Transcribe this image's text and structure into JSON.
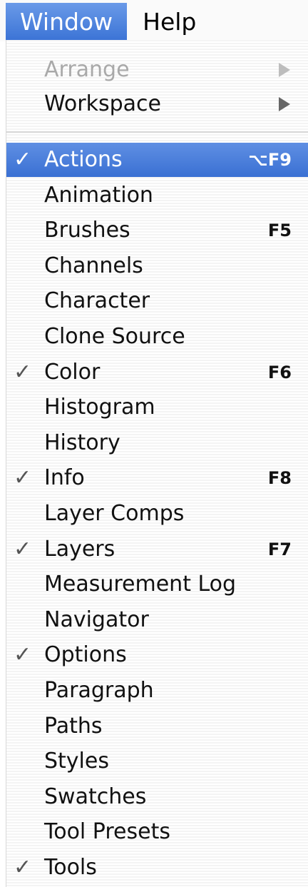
{
  "menubar": {
    "items": [
      {
        "label": "Window"
      },
      {
        "label": "Help"
      }
    ]
  },
  "menu": {
    "top_items": [
      {
        "label": "Arrange",
        "submenu": true,
        "enabled": false
      },
      {
        "label": "Workspace",
        "submenu": true,
        "enabled": true
      }
    ],
    "items": [
      {
        "label": "Actions",
        "checked": true,
        "shortcut": "⌥F9",
        "highlighted": true
      },
      {
        "label": "Animation",
        "checked": false,
        "shortcut": ""
      },
      {
        "label": "Brushes",
        "checked": false,
        "shortcut": "F5"
      },
      {
        "label": "Channels",
        "checked": false,
        "shortcut": ""
      },
      {
        "label": "Character",
        "checked": false,
        "shortcut": ""
      },
      {
        "label": "Clone Source",
        "checked": false,
        "shortcut": ""
      },
      {
        "label": "Color",
        "checked": true,
        "shortcut": "F6"
      },
      {
        "label": "Histogram",
        "checked": false,
        "shortcut": ""
      },
      {
        "label": "History",
        "checked": false,
        "shortcut": ""
      },
      {
        "label": "Info",
        "checked": true,
        "shortcut": "F8"
      },
      {
        "label": "Layer Comps",
        "checked": false,
        "shortcut": ""
      },
      {
        "label": "Layers",
        "checked": true,
        "shortcut": "F7"
      },
      {
        "label": "Measurement Log",
        "checked": false,
        "shortcut": ""
      },
      {
        "label": "Navigator",
        "checked": false,
        "shortcut": ""
      },
      {
        "label": "Options",
        "checked": true,
        "shortcut": ""
      },
      {
        "label": "Paragraph",
        "checked": false,
        "shortcut": ""
      },
      {
        "label": "Paths",
        "checked": false,
        "shortcut": ""
      },
      {
        "label": "Styles",
        "checked": false,
        "shortcut": ""
      },
      {
        "label": "Swatches",
        "checked": false,
        "shortcut": ""
      },
      {
        "label": "Tool Presets",
        "checked": false,
        "shortcut": ""
      },
      {
        "label": "Tools",
        "checked": true,
        "shortcut": ""
      }
    ],
    "check_glyph": "✓"
  }
}
